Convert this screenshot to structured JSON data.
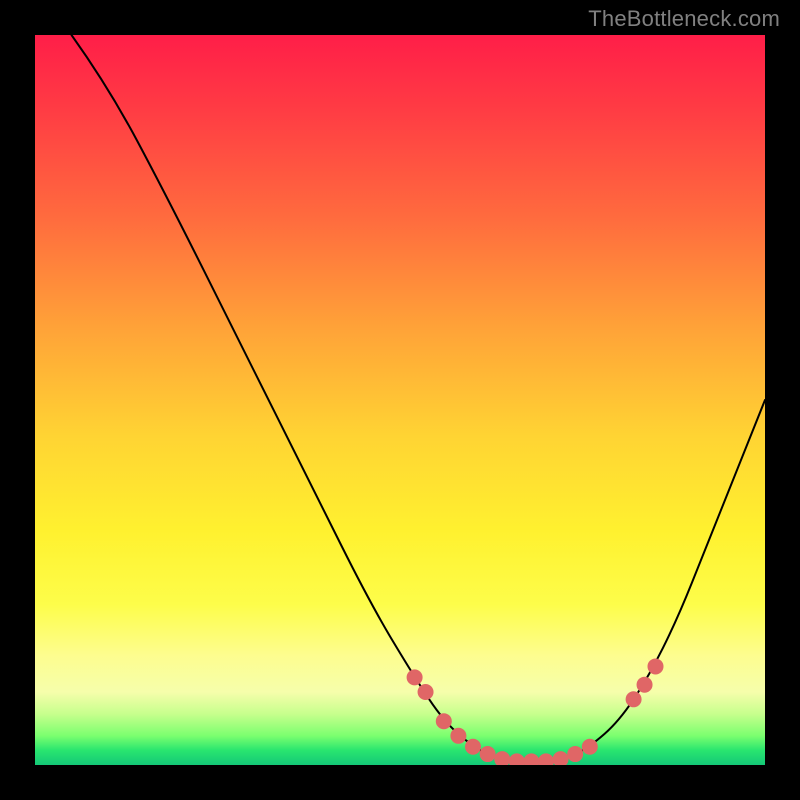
{
  "watermark": "TheBottleneck.com",
  "chart_data": {
    "type": "line",
    "title": "",
    "xlabel": "",
    "ylabel": "",
    "xlim": [
      0,
      100
    ],
    "ylim": [
      0,
      100
    ],
    "background_gradient": {
      "direction": "vertical",
      "stops": [
        {
          "pos": 0,
          "color": "#ff1e48"
        },
        {
          "pos": 10,
          "color": "#ff3b44"
        },
        {
          "pos": 25,
          "color": "#ff6b3e"
        },
        {
          "pos": 40,
          "color": "#ffa238"
        },
        {
          "pos": 55,
          "color": "#ffd433"
        },
        {
          "pos": 68,
          "color": "#fff12f"
        },
        {
          "pos": 78,
          "color": "#fdfd4a"
        },
        {
          "pos": 85,
          "color": "#fdfd8f"
        },
        {
          "pos": 90,
          "color": "#f6feab"
        },
        {
          "pos": 93,
          "color": "#c7ff8d"
        },
        {
          "pos": 96,
          "color": "#7bff6f"
        },
        {
          "pos": 98,
          "color": "#29e56f"
        },
        {
          "pos": 100,
          "color": "#14c877"
        }
      ]
    },
    "series": [
      {
        "name": "curve",
        "color": "#000000",
        "width": 2,
        "points": [
          {
            "x": 5,
            "y": 100
          },
          {
            "x": 10,
            "y": 93
          },
          {
            "x": 18,
            "y": 78
          },
          {
            "x": 28,
            "y": 58
          },
          {
            "x": 38,
            "y": 38
          },
          {
            "x": 46,
            "y": 22
          },
          {
            "x": 52,
            "y": 12
          },
          {
            "x": 56,
            "y": 6
          },
          {
            "x": 60,
            "y": 2.5
          },
          {
            "x": 63,
            "y": 1
          },
          {
            "x": 66,
            "y": 0.5
          },
          {
            "x": 70,
            "y": 0.5
          },
          {
            "x": 73,
            "y": 1
          },
          {
            "x": 76,
            "y": 2.5
          },
          {
            "x": 80,
            "y": 6
          },
          {
            "x": 84,
            "y": 12
          },
          {
            "x": 88,
            "y": 20
          },
          {
            "x": 92,
            "y": 30
          },
          {
            "x": 96,
            "y": 40
          },
          {
            "x": 100,
            "y": 50
          }
        ]
      },
      {
        "name": "markers",
        "color": "#e06666",
        "marker_radius": 8,
        "points": [
          {
            "x": 52,
            "y": 12
          },
          {
            "x": 53.5,
            "y": 10
          },
          {
            "x": 56,
            "y": 6
          },
          {
            "x": 58,
            "y": 4
          },
          {
            "x": 60,
            "y": 2.5
          },
          {
            "x": 62,
            "y": 1.5
          },
          {
            "x": 64,
            "y": 0.8
          },
          {
            "x": 66,
            "y": 0.5
          },
          {
            "x": 68,
            "y": 0.5
          },
          {
            "x": 70,
            "y": 0.5
          },
          {
            "x": 72,
            "y": 0.8
          },
          {
            "x": 74,
            "y": 1.5
          },
          {
            "x": 76,
            "y": 2.5
          },
          {
            "x": 82,
            "y": 9
          },
          {
            "x": 83.5,
            "y": 11
          },
          {
            "x": 85,
            "y": 13.5
          }
        ]
      }
    ]
  }
}
